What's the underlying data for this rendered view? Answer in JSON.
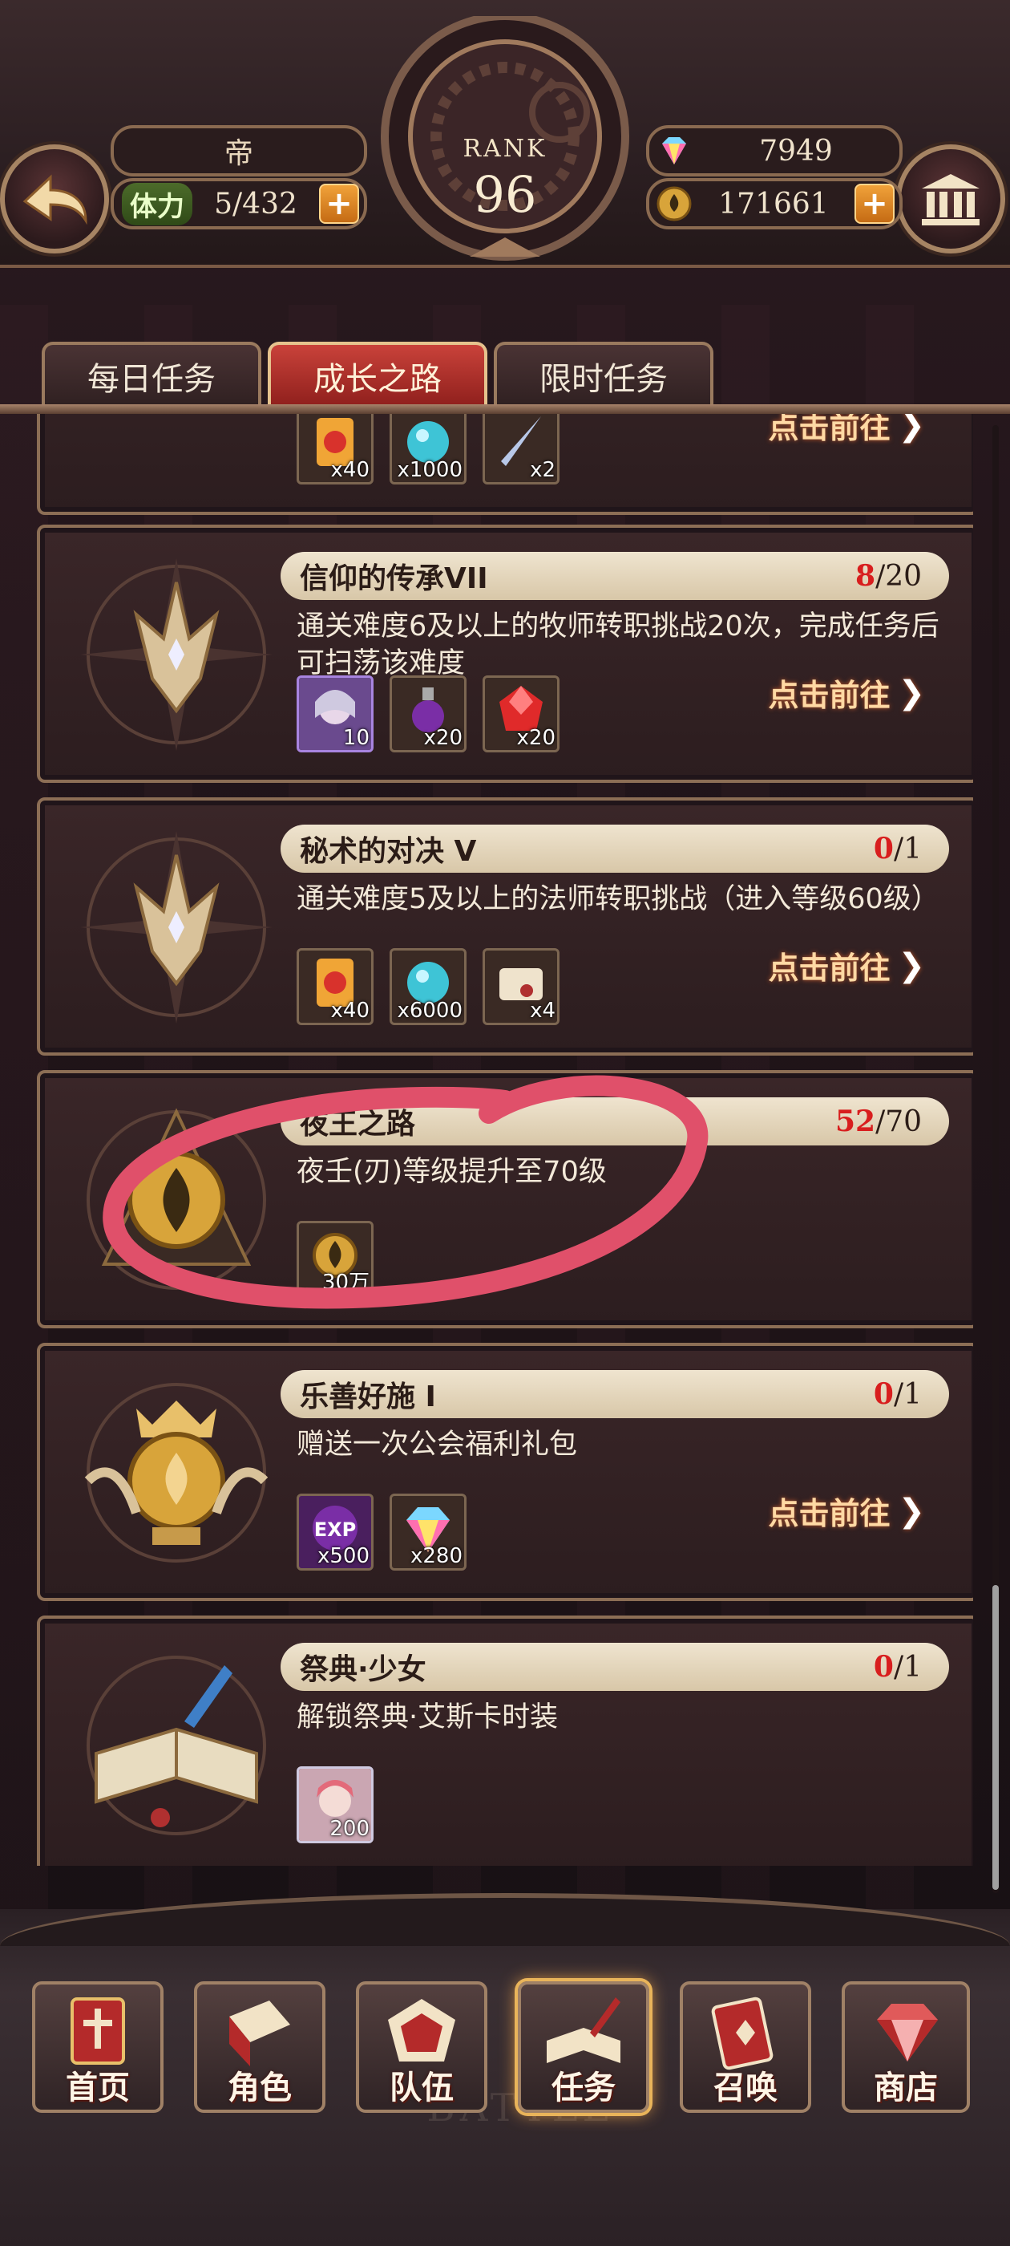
{
  "header": {
    "player_name": "帝",
    "stamina_label": "体力",
    "stamina_value": "5/432",
    "gems": "7949",
    "gold": "171661",
    "rank_label": "RANK",
    "rank_value": "96",
    "plus_symbol": "+"
  },
  "tabs": [
    {
      "label": "每日任务"
    },
    {
      "label": "成长之路"
    },
    {
      "label": "限时任务"
    }
  ],
  "active_tab": "成长之路",
  "tasks": [
    {
      "title": "",
      "progress_current": "",
      "progress_total": "",
      "description": "",
      "rewards": [
        {
          "qty": "x40"
        },
        {
          "qty": "x1000"
        },
        {
          "qty": "x2"
        }
      ],
      "action": "点击前往"
    },
    {
      "title": "信仰的传承VII",
      "progress_current": "8",
      "progress_total": "/20",
      "description": "通关难度6及以上的牧师转职挑战20次，完成任务后可扫荡该难度",
      "rewards": [
        {
          "qty": "10"
        },
        {
          "qty": "x20"
        },
        {
          "qty": "x20"
        }
      ],
      "action": "点击前往"
    },
    {
      "title": "秘术的对决 V",
      "progress_current": "0",
      "progress_total": "/1",
      "description": "通关难度5及以上的法师转职挑战（进入等级60级）",
      "rewards": [
        {
          "qty": "x40"
        },
        {
          "qty": "x6000"
        },
        {
          "qty": "x4"
        }
      ],
      "action": "点击前往"
    },
    {
      "title": "夜王之路",
      "progress_current": "52",
      "progress_total": "/70",
      "description": "夜壬(刃)等级提升至70级",
      "rewards": [
        {
          "qty": "30万"
        }
      ],
      "action": ""
    },
    {
      "title": "乐善好施 I",
      "progress_current": "0",
      "progress_total": "/1",
      "description": "赠送一次公会福利礼包",
      "rewards": [
        {
          "qty": "x500"
        },
        {
          "qty": "x280"
        }
      ],
      "action": "点击前往"
    },
    {
      "title": "祭典·少女",
      "progress_current": "0",
      "progress_total": "/1",
      "description": "解锁祭典·艾斯卡时装",
      "rewards": [
        {
          "qty": "200"
        }
      ],
      "action": ""
    }
  ],
  "reward_badge": {
    "exp": "EXP"
  },
  "bottom_nav": [
    {
      "label": "首页"
    },
    {
      "label": "角色"
    },
    {
      "label": "队伍"
    },
    {
      "label": "任务"
    },
    {
      "label": "召唤"
    },
    {
      "label": "商店"
    }
  ],
  "colors": {
    "accent_red": "#d81e1e",
    "annotation_stroke": "#e0506a",
    "gold_text": "#ffd9a4"
  }
}
